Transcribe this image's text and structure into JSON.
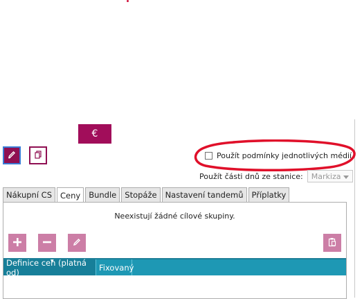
{
  "toolbar": {
    "currency_label": "€",
    "edit_icon": "pencil-icon",
    "copy_icon": "copy-icon"
  },
  "options": {
    "media_conditions_label": "Použít podmínky jednotlivých médií",
    "media_conditions_checked": false,
    "day_parts_label": "Použít části dnů ze stanice:",
    "day_parts_station": "Markiza"
  },
  "tabs": [
    {
      "label": "Nákupní CS",
      "active": false
    },
    {
      "label": "Ceny",
      "active": true
    },
    {
      "label": "Bundle",
      "active": false
    },
    {
      "label": "Stopáže",
      "active": false
    },
    {
      "label": "Nastavení tandemů",
      "active": false
    },
    {
      "label": "Příplatky",
      "active": false
    }
  ],
  "panel": {
    "empty_message": "Neexistují žádné cílové skupiny.",
    "actions": [
      "add-icon",
      "remove-icon",
      "pencil-icon",
      "paste-icon"
    ]
  },
  "grid": {
    "columns": [
      "Definice cen (platná od)",
      "Fixovaný"
    ]
  },
  "colors": {
    "brand": "#a10d5a",
    "grid_header": "#1e98b4",
    "annotation": "#e0102a"
  }
}
